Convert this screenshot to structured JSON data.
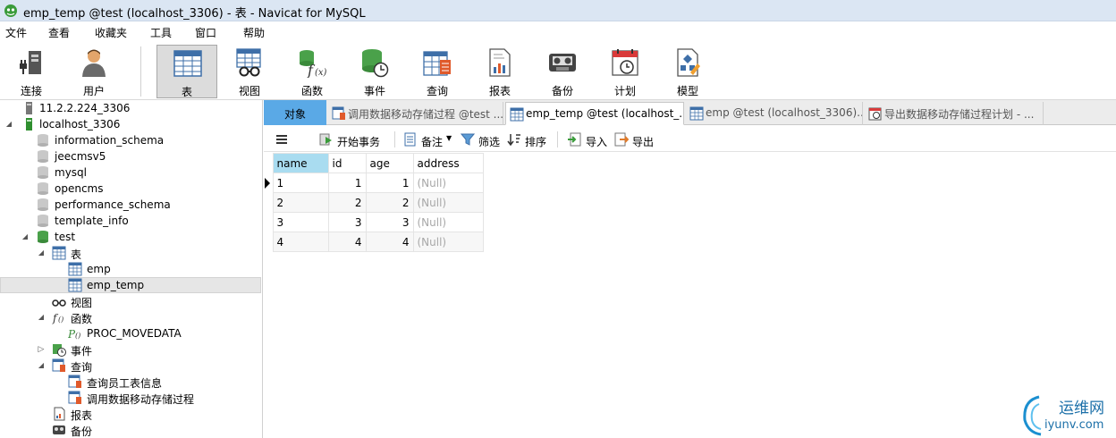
{
  "window": {
    "title": "emp_temp @test (localhost_3306) - 表 - Navicat for MySQL"
  },
  "menu": [
    "文件",
    "查看",
    "收藏夹",
    "工具",
    "窗口",
    "帮助"
  ],
  "toolbar": [
    {
      "label": "连接",
      "icon": "connection-icon"
    },
    {
      "label": "用户",
      "icon": "user-icon"
    },
    {
      "label": "表",
      "icon": "table-icon"
    },
    {
      "label": "视图",
      "icon": "view-icon"
    },
    {
      "label": "函数",
      "icon": "function-icon"
    },
    {
      "label": "事件",
      "icon": "event-icon"
    },
    {
      "label": "查询",
      "icon": "query-icon"
    },
    {
      "label": "报表",
      "icon": "report-icon"
    },
    {
      "label": "备份",
      "icon": "backup-icon"
    },
    {
      "label": "计划",
      "icon": "schedule-icon"
    },
    {
      "label": "模型",
      "icon": "model-icon"
    }
  ],
  "sidebar": {
    "nodes": [
      {
        "label": "11.2.2.224_3306",
        "icon": "connection-icon"
      },
      {
        "label": "localhost_3306",
        "icon": "connection-icon"
      },
      {
        "label": "information_schema",
        "icon": "database-icon"
      },
      {
        "label": "jeecmsv5",
        "icon": "database-icon"
      },
      {
        "label": "mysql",
        "icon": "database-icon"
      },
      {
        "label": "opencms",
        "icon": "database-icon"
      },
      {
        "label": "performance_schema",
        "icon": "database-icon"
      },
      {
        "label": "template_info",
        "icon": "database-icon"
      },
      {
        "label": "test",
        "icon": "database-icon"
      },
      {
        "label": "表",
        "icon": "table-icon"
      },
      {
        "label": "emp",
        "icon": "table-icon"
      },
      {
        "label": "emp_temp",
        "icon": "table-icon"
      },
      {
        "label": "视图",
        "icon": "view-icon"
      },
      {
        "label": "函数",
        "icon": "function-icon"
      },
      {
        "label": "PROC_MOVEDATA",
        "icon": "procedure-icon"
      },
      {
        "label": "事件",
        "icon": "event-icon"
      },
      {
        "label": "查询",
        "icon": "query-icon"
      },
      {
        "label": "查询员工表信息",
        "icon": "query-icon"
      },
      {
        "label": "调用数据移动存储过程",
        "icon": "query-icon"
      },
      {
        "label": "报表",
        "icon": "report-icon"
      },
      {
        "label": "备份",
        "icon": "backup-icon"
      }
    ]
  },
  "tabs": [
    {
      "label": "对象"
    },
    {
      "label": "调用数据移动存储过程 @test ..."
    },
    {
      "label": "emp_temp @test (localhost_..."
    },
    {
      "label": "emp @test (localhost_3306)..."
    },
    {
      "label": "导出数据移动存储过程计划 - ..."
    }
  ],
  "subtoolbar": {
    "begin_transaction": "开始事务",
    "memo": "备注",
    "filter": "筛选",
    "sort": "排序",
    "import": "导入",
    "export": "导出"
  },
  "grid": {
    "columns": [
      "name",
      "id",
      "age",
      "address"
    ],
    "rows": [
      [
        "1",
        "1",
        "1",
        "(Null)"
      ],
      [
        "2",
        "2",
        "2",
        "(Null)"
      ],
      [
        "3",
        "3",
        "3",
        "(Null)"
      ],
      [
        "4",
        "4",
        "4",
        "(Null)"
      ]
    ]
  },
  "watermark": {
    "title": "运维网",
    "url": "iyunv.com"
  },
  "colors": {
    "accent": "#5aa9e6",
    "column_highlight": "#a9dcf0",
    "titlebar": "#dbe6f3"
  }
}
